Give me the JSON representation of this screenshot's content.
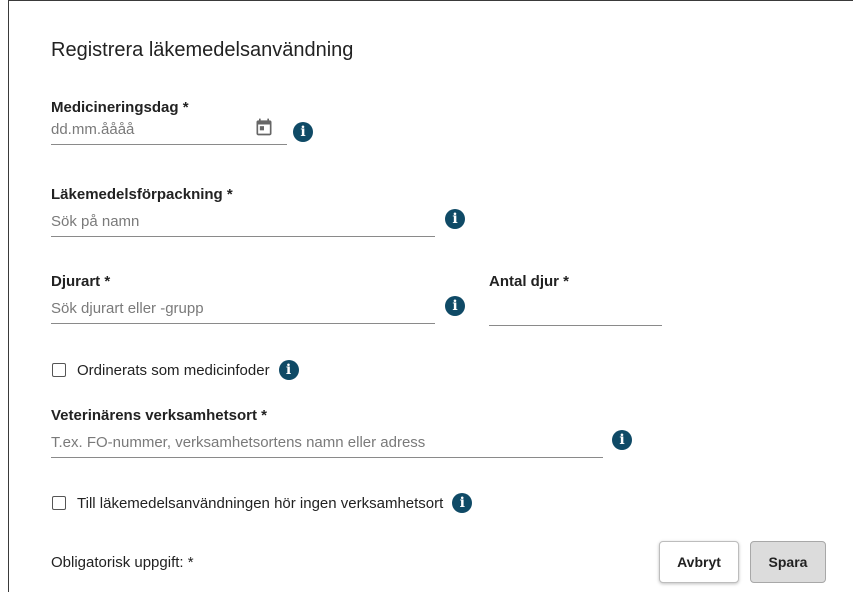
{
  "form": {
    "title": "Registrera läkemedelsanvändning",
    "medication_day": {
      "label": "Medicineringsdag *",
      "placeholder": "dd.mm.åååå",
      "icon": "calendar-icon"
    },
    "package": {
      "label": "Läkemedelsförpackning *",
      "placeholder": "Sök på namn"
    },
    "species": {
      "label": "Djurart *",
      "placeholder": "Sök djurart eller -grupp"
    },
    "animal_count": {
      "label": "Antal djur *",
      "value": ""
    },
    "medicated_feed": {
      "label": "Ordinerats som medicinfoder",
      "checked": false
    },
    "vet_location": {
      "label": "Veterinärens verksamhetsort *",
      "placeholder": "T.ex. FO-nummer, verksamhetsortens namn eller adress"
    },
    "no_location": {
      "label": "Till läkemedelsanvändningen hör ingen verksamhetsort",
      "checked": false
    },
    "required_note": "Obligatorisk uppgift: *",
    "info_icon_glyph": "i"
  },
  "buttons": {
    "cancel": "Avbryt",
    "save": "Spara"
  },
  "colors": {
    "info_icon": "#0f4a66",
    "save_button_bg": "#dcdcdc"
  }
}
